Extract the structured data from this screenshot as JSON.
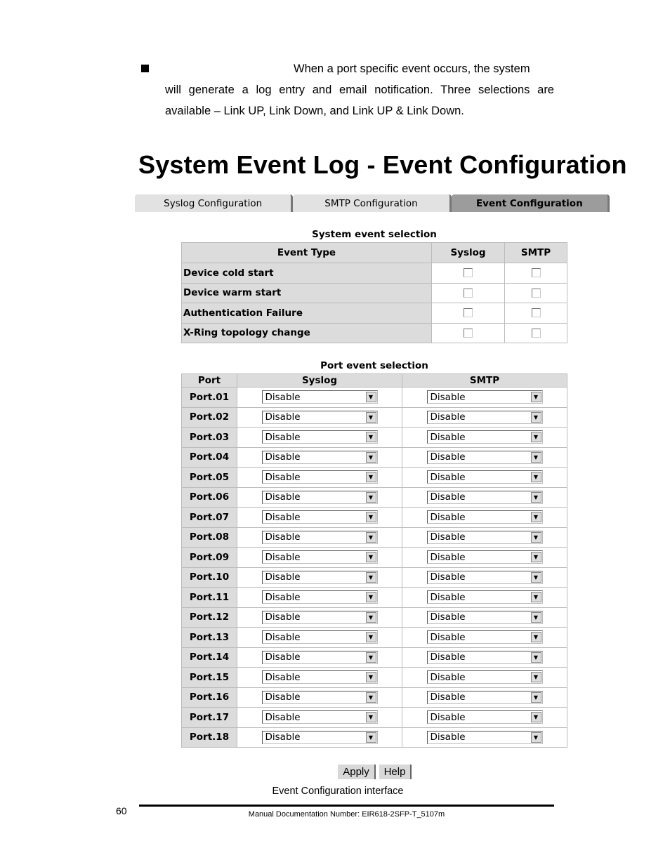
{
  "intro": {
    "line1": "When a port specific event occurs, the system",
    "line2": "will generate a log entry and email notification. Three selections are",
    "line3": "available – Link UP, Link Down, and Link UP & Link Down."
  },
  "title": "System Event Log - Event Configuration",
  "tabs": [
    {
      "label": "Syslog Configuration",
      "active": false
    },
    {
      "label": "SMTP Configuration",
      "active": false
    },
    {
      "label": "Event Configuration",
      "active": true
    }
  ],
  "system_events": {
    "caption": "System event selection",
    "headers": [
      "Event Type",
      "Syslog",
      "SMTP"
    ],
    "rows": [
      {
        "label": "Device cold start",
        "syslog": false,
        "smtp": false
      },
      {
        "label": "Device warm start",
        "syslog": false,
        "smtp": false
      },
      {
        "label": "Authentication Failure",
        "syslog": false,
        "smtp": false
      },
      {
        "label": "X-Ring topology change",
        "syslog": false,
        "smtp": false
      }
    ]
  },
  "port_events": {
    "caption": "Port event selection",
    "headers": [
      "Port",
      "Syslog",
      "SMTP"
    ],
    "rows": [
      {
        "port": "Port.01",
        "syslog": "Disable",
        "smtp": "Disable"
      },
      {
        "port": "Port.02",
        "syslog": "Disable",
        "smtp": "Disable"
      },
      {
        "port": "Port.03",
        "syslog": "Disable",
        "smtp": "Disable"
      },
      {
        "port": "Port.04",
        "syslog": "Disable",
        "smtp": "Disable"
      },
      {
        "port": "Port.05",
        "syslog": "Disable",
        "smtp": "Disable"
      },
      {
        "port": "Port.06",
        "syslog": "Disable",
        "smtp": "Disable"
      },
      {
        "port": "Port.07",
        "syslog": "Disable",
        "smtp": "Disable"
      },
      {
        "port": "Port.08",
        "syslog": "Disable",
        "smtp": "Disable"
      },
      {
        "port": "Port.09",
        "syslog": "Disable",
        "smtp": "Disable"
      },
      {
        "port": "Port.10",
        "syslog": "Disable",
        "smtp": "Disable"
      },
      {
        "port": "Port.11",
        "syslog": "Disable",
        "smtp": "Disable"
      },
      {
        "port": "Port.12",
        "syslog": "Disable",
        "smtp": "Disable"
      },
      {
        "port": "Port.13",
        "syslog": "Disable",
        "smtp": "Disable"
      },
      {
        "port": "Port.14",
        "syslog": "Disable",
        "smtp": "Disable"
      },
      {
        "port": "Port.15",
        "syslog": "Disable",
        "smtp": "Disable"
      },
      {
        "port": "Port.16",
        "syslog": "Disable",
        "smtp": "Disable"
      },
      {
        "port": "Port.17",
        "syslog": "Disable",
        "smtp": "Disable"
      },
      {
        "port": "Port.18",
        "syslog": "Disable",
        "smtp": "Disable"
      }
    ]
  },
  "buttons": {
    "apply": "Apply",
    "help": "Help"
  },
  "figure_caption": "Event Configuration interface",
  "footer": {
    "page_number": "60",
    "doc_number": "Manual Documentation Number: EIR618-2SFP-T_5107m"
  }
}
